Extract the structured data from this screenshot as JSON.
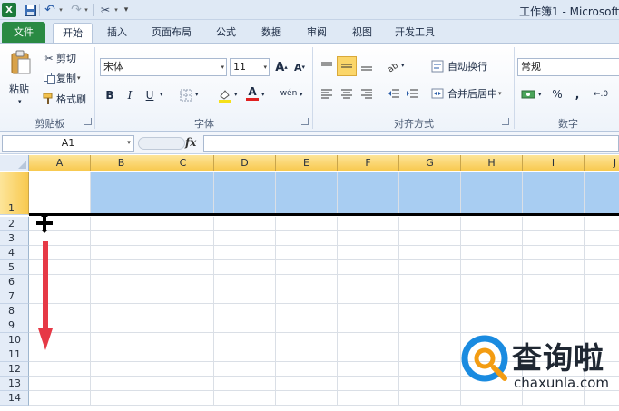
{
  "window": {
    "title": "工作簿1 - Microsoft",
    "app_icon": "X"
  },
  "quick_access": {
    "save_icon": "💾",
    "undo_icon": "↶",
    "redo_icon": "↷",
    "tools_icon": "✂",
    "dropdown": "▾",
    "customize": "▾"
  },
  "tabs": {
    "file": "文件",
    "home": "开始",
    "insert": "插入",
    "page_layout": "页面布局",
    "formulas": "公式",
    "data": "数据",
    "review": "审阅",
    "view": "视图",
    "developer": "开发工具"
  },
  "clipboard": {
    "paste_label": "粘贴",
    "cut_label": "剪切",
    "copy_label": "复制",
    "format_painter_label": "格式刷",
    "group_label": "剪贴板"
  },
  "font": {
    "font_name": "宋体",
    "font_size": "11",
    "grow_icon": "A",
    "shrink_icon": "A",
    "bold": "B",
    "italic": "I",
    "underline": "U",
    "font_color_icon": "A",
    "phonetic_icon": "wén",
    "group_label": "字体"
  },
  "alignment": {
    "wrap_text_label": "自动换行",
    "merge_center_label": "合并后居中",
    "group_label": "对齐方式"
  },
  "number": {
    "format": "常规",
    "percent": "%",
    "comma": ",",
    "group_label": "数字"
  },
  "formula_bar": {
    "name_box": "A1",
    "fx": "fx",
    "formula": ""
  },
  "sheet": {
    "columns": [
      "A",
      "B",
      "C",
      "D",
      "E",
      "F",
      "G",
      "H",
      "I",
      "J"
    ],
    "rows": [
      "1",
      "2",
      "3",
      "4",
      "5",
      "6",
      "7",
      "8",
      "9",
      "10",
      "11",
      "12",
      "13",
      "14"
    ],
    "active_cell": "A1",
    "selection_color": "#a8cdf2",
    "header_highlight": "#f8c94f"
  },
  "annotation": {
    "arrow_color": "#e63946"
  },
  "watermark": {
    "brand": "查询啦",
    "url": "chaxunla.com",
    "logo_color": "#1a8be0",
    "logo_accent": "#f39c12"
  }
}
